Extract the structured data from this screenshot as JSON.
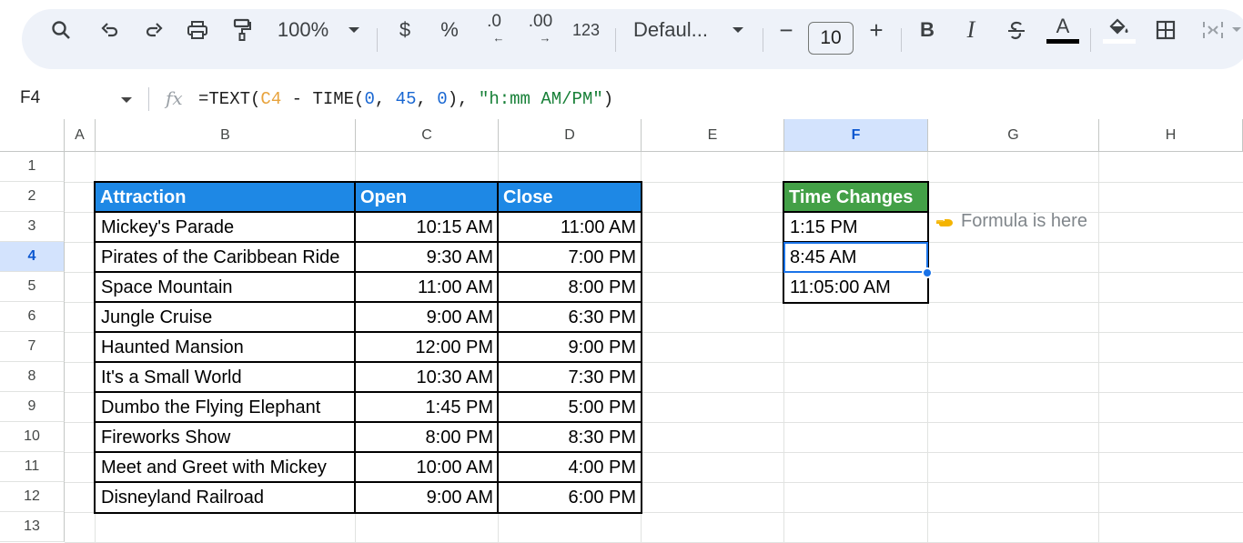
{
  "toolbar": {
    "zoom": "100%",
    "currency": "$",
    "percent": "%",
    "decrease_decimal": ".0",
    "increase_decimal": ".00",
    "number_format": "123",
    "font_name": "Defaul...",
    "font_size": "10",
    "minus": "−",
    "plus": "+",
    "bold": "B",
    "italic": "I",
    "text_color_letter": "A"
  },
  "formula_bar": {
    "name_box": "F4",
    "fx": "fx",
    "formula_prefix": "=TEXT(",
    "ref": "C4",
    "mid1": " - TIME(",
    "n1": "0",
    "c1": ", ",
    "n2": "45",
    "c2": ", ",
    "n3": "0",
    "mid2": "), ",
    "str": "\"h:mm AM/PM\"",
    "end": ")"
  },
  "columns": [
    "A",
    "B",
    "C",
    "D",
    "E",
    "F",
    "G",
    "H"
  ],
  "rows": [
    "1",
    "2",
    "3",
    "4",
    "5",
    "6",
    "7",
    "8",
    "9",
    "10",
    "11",
    "12",
    "13"
  ],
  "table": {
    "headers": [
      "Attraction",
      "Open",
      "Close"
    ],
    "rows": [
      [
        "Mickey's Parade",
        "10:15 AM",
        "11:00 AM"
      ],
      [
        "Pirates of the Caribbean Ride",
        "9:30 AM",
        "7:00 PM"
      ],
      [
        "Space Mountain",
        "11:00 AM",
        "8:00 PM"
      ],
      [
        "Jungle Cruise",
        "9:00 AM",
        "6:30 PM"
      ],
      [
        "Haunted Mansion",
        "12:00 PM",
        "9:00 PM"
      ],
      [
        "It's a Small World",
        "10:30 AM",
        "7:30 PM"
      ],
      [
        "Dumbo the Flying Elephant",
        "1:45 PM",
        "5:00 PM"
      ],
      [
        "Fireworks Show",
        "8:00 PM",
        "8:30 PM"
      ],
      [
        "Meet and Greet with Mickey",
        "10:00 AM",
        "4:00 PM"
      ],
      [
        "Disneyland Railroad",
        "9:00 AM",
        "6:00 PM"
      ]
    ]
  },
  "time_changes": {
    "header": "Time Changes",
    "values": [
      "1:15 PM",
      "8:45 AM",
      "11:05:00 AM"
    ]
  },
  "note": "Formula is here",
  "colors": {
    "header_blue": "#1e88e5",
    "header_green": "#43a047",
    "selection": "#1a73e8"
  }
}
